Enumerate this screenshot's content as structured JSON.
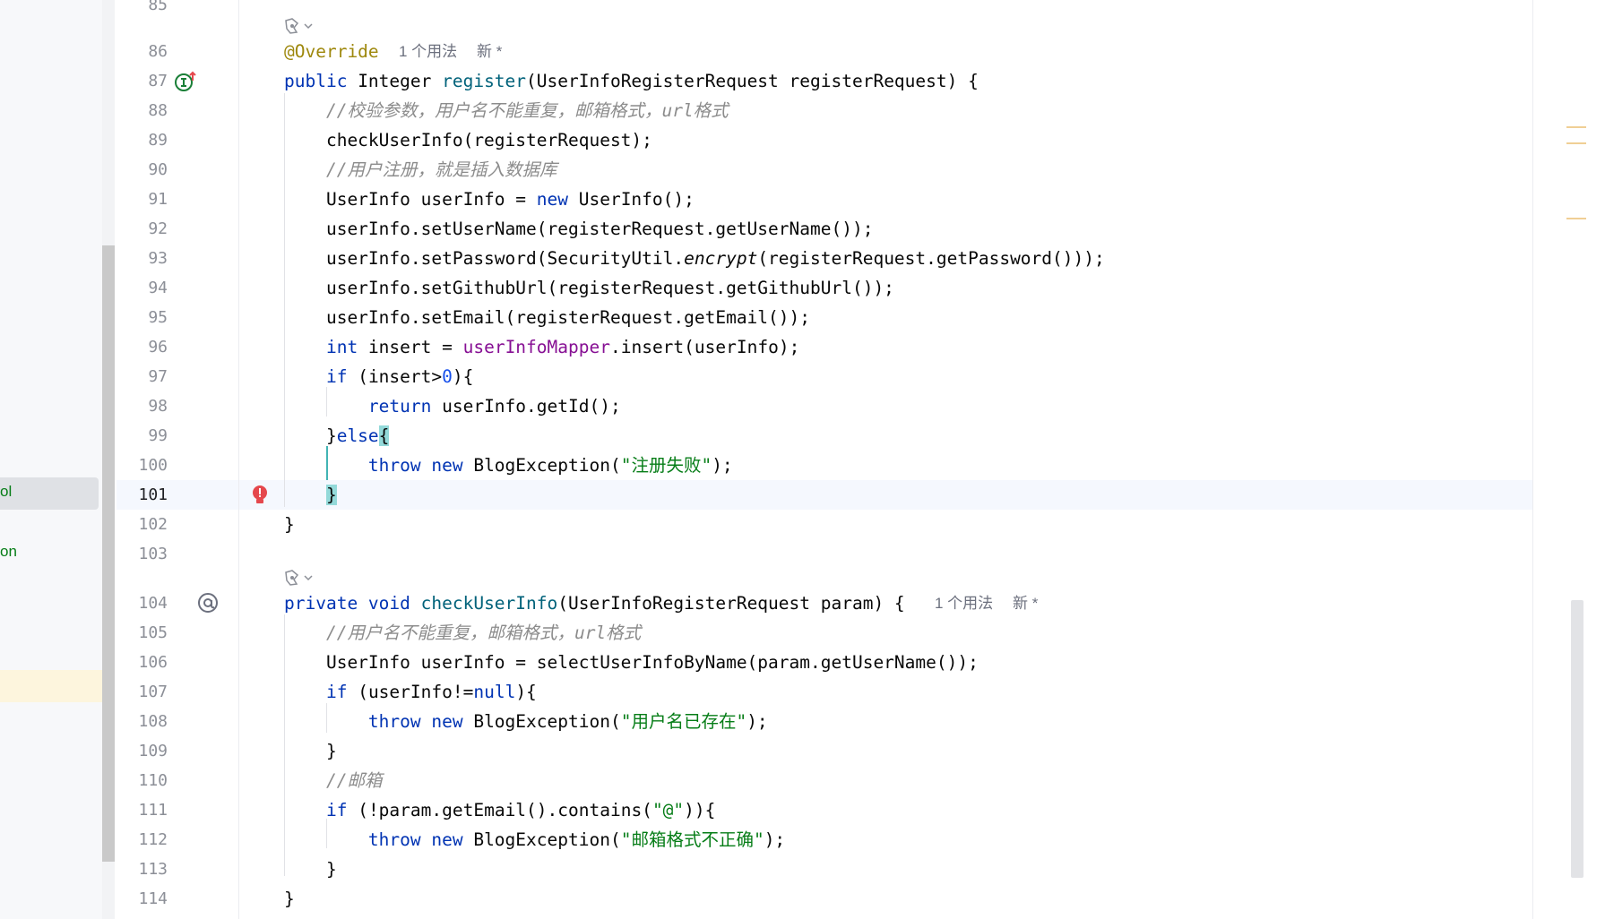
{
  "sidebar": {
    "selected_item_fragment": "ol",
    "other_item_fragment": "on"
  },
  "editor": {
    "top_partial_line": "85",
    "hints": {
      "register_usages": "1 个用法",
      "register_new": "新 *",
      "check_usages": "1 个用法",
      "check_new": "新 *"
    },
    "lines": [
      {
        "n": "86",
        "tokens": [
          [
            "an",
            "@Override"
          ]
        ]
      },
      {
        "n": "87",
        "tokens": [
          [
            "kw",
            "public "
          ],
          [
            "",
            "Integer "
          ],
          [
            "fn",
            "register"
          ],
          [
            "",
            "(UserInfoRegisterRequest registerRequest) {"
          ]
        ]
      },
      {
        "n": "88",
        "tokens": [
          [
            "",
            "    "
          ],
          [
            "cmt",
            "//校验参数，用户名不能重复，邮箱格式，url格式"
          ]
        ]
      },
      {
        "n": "89",
        "tokens": [
          [
            "",
            "    checkUserInfo(registerRequest);"
          ]
        ]
      },
      {
        "n": "90",
        "tokens": [
          [
            "",
            "    "
          ],
          [
            "cmt",
            "//用户注册，就是插入数据库"
          ]
        ]
      },
      {
        "n": "91",
        "tokens": [
          [
            "",
            "    UserInfo userInfo = "
          ],
          [
            "kw",
            "new "
          ],
          [
            "",
            "UserInfo();"
          ]
        ]
      },
      {
        "n": "92",
        "tokens": [
          [
            "",
            "    userInfo.setUserName(registerRequest.getUserName());"
          ]
        ]
      },
      {
        "n": "93",
        "tokens": [
          [
            "",
            "    userInfo.setPassword(SecurityUtil."
          ],
          [
            "ital",
            "encrypt"
          ],
          [
            "",
            "(registerRequest.getPassword()));"
          ]
        ]
      },
      {
        "n": "94",
        "tokens": [
          [
            "",
            "    userInfo.setGithubUrl(registerRequest.getGithubUrl());"
          ]
        ]
      },
      {
        "n": "95",
        "tokens": [
          [
            "",
            "    userInfo.setEmail(registerRequest.getEmail());"
          ]
        ]
      },
      {
        "n": "96",
        "tokens": [
          [
            "",
            "    "
          ],
          [
            "kw",
            "int "
          ],
          [
            "",
            "insert = "
          ],
          [
            "fld",
            "userInfoMapper"
          ],
          [
            "",
            ".insert(userInfo);"
          ]
        ]
      },
      {
        "n": "97",
        "tokens": [
          [
            "",
            "    "
          ],
          [
            "kw",
            "if "
          ],
          [
            "",
            "(insert>"
          ],
          [
            "num",
            "0"
          ],
          [
            "",
            "){"
          ]
        ]
      },
      {
        "n": "98",
        "tokens": [
          [
            "",
            "        "
          ],
          [
            "kw",
            "return "
          ],
          [
            "",
            "userInfo.getId();"
          ]
        ]
      },
      {
        "n": "99",
        "tokens": [
          [
            "",
            "    }"
          ],
          [
            "kw",
            "else"
          ],
          [
            "brace-hl",
            "{"
          ]
        ]
      },
      {
        "n": "100",
        "tokens": [
          [
            "",
            "        "
          ],
          [
            "kw",
            "throw new "
          ],
          [
            "",
            "BlogException("
          ],
          [
            "str",
            "\"注册失败\""
          ],
          [
            "",
            ");"
          ]
        ]
      },
      {
        "n": "101",
        "tokens": [
          [
            "",
            "    "
          ],
          [
            "brace-hl",
            "}"
          ]
        ]
      },
      {
        "n": "102",
        "tokens": [
          [
            "",
            "}"
          ]
        ]
      },
      {
        "n": "103",
        "tokens": []
      },
      {
        "n": "104",
        "tokens": [
          [
            "kw",
            "private void "
          ],
          [
            "fn",
            "checkUserInfo"
          ],
          [
            "",
            "(UserInfoRegisterRequest param) {"
          ]
        ]
      },
      {
        "n": "105",
        "tokens": [
          [
            "",
            "    "
          ],
          [
            "cmt",
            "//用户名不能重复，邮箱格式，url格式"
          ]
        ]
      },
      {
        "n": "106",
        "tokens": [
          [
            "",
            "    UserInfo userInfo = selectUserInfoByName(param.getUserName());"
          ]
        ]
      },
      {
        "n": "107",
        "tokens": [
          [
            "",
            "    "
          ],
          [
            "kw",
            "if "
          ],
          [
            "",
            "(userInfo!="
          ],
          [
            "kw",
            "null"
          ],
          [
            "",
            "){"
          ]
        ]
      },
      {
        "n": "108",
        "tokens": [
          [
            "",
            "        "
          ],
          [
            "kw",
            "throw new "
          ],
          [
            "",
            "BlogException("
          ],
          [
            "str",
            "\"用户名已存在\""
          ],
          [
            "",
            ");"
          ]
        ]
      },
      {
        "n": "109",
        "tokens": [
          [
            "",
            "    }"
          ]
        ]
      },
      {
        "n": "110",
        "tokens": [
          [
            "",
            "    "
          ],
          [
            "cmt",
            "//邮箱"
          ]
        ]
      },
      {
        "n": "111",
        "tokens": [
          [
            "",
            "    "
          ],
          [
            "kw",
            "if "
          ],
          [
            "",
            "(!param.getEmail().contains("
          ],
          [
            "str",
            "\"@\""
          ],
          [
            "",
            "))"
          ],
          [
            "",
            "{"
          ]
        ]
      },
      {
        "n": "112",
        "tokens": [
          [
            "",
            "        "
          ],
          [
            "kw",
            "throw new "
          ],
          [
            "",
            "BlogException("
          ],
          [
            "str",
            "\"邮箱格式不正确\""
          ],
          [
            "",
            ");"
          ]
        ]
      },
      {
        "n": "113",
        "tokens": [
          [
            "",
            "    }"
          ]
        ]
      },
      {
        "n": "114",
        "tokens": [
          [
            "",
            "}"
          ]
        ]
      }
    ]
  },
  "colors": {
    "keyword": "#0033b3",
    "method": "#00627a",
    "annotation": "#9e880d",
    "field": "#871094",
    "string": "#067d17",
    "comment": "#8c8c8c",
    "error": "#e5484d",
    "implements": "#1a7f37"
  },
  "icons": [
    "implements-method-icon",
    "error-bulb-icon",
    "method-annotation-icon",
    "ai-code-vision-icon",
    "chevron-down-icon"
  ]
}
